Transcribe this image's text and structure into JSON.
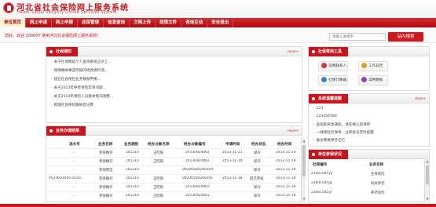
{
  "header": {
    "title": "河北省社会保险网上服务系统",
    "subtitle": "Hebei Social Security Online Services System"
  },
  "nav": {
    "items": [
      {
        "label": "单位首页"
      },
      {
        "label": "网上申请"
      },
      {
        "label": "网上申报"
      },
      {
        "label": "总保管理"
      },
      {
        "label": "信息查询"
      },
      {
        "label": "文档上传"
      },
      {
        "label": "政策文件"
      },
      {
        "label": "咨询互动"
      },
      {
        "label": "安全退出"
      }
    ]
  },
  "notice": {
    "text": "您好，欢迎 10000T 使用河北社会保险网上服务系统!"
  },
  "search": {
    "placeholder": "请输入关键字",
    "button_label": "站内搜索"
  },
  "announcements": {
    "title": "社保通知",
    "more": "more+",
    "items": [
      "关于社保网站个人查询系统正式上...",
      "保障缴纳事宜所报的修改资料须...",
      "建立社会保险业务数据申报...",
      "关于2013年养老保险年审问题...",
      "关于2014年保险人员基本情况调整...",
      "管理社会保险缴纳登记费"
    ]
  },
  "business": {
    "title": "业务办理结果",
    "more": "more+",
    "columns": [
      "流水号",
      "业务名称",
      "业务期别",
      "经办对象名称",
      "经办对象编号",
      "申请时间",
      "经办状态",
      "经办时间"
    ],
    "rows": [
      [
        "…",
        "参保缴存",
        "201310",
        "王昭阳",
        "20130924002",
        "2013-11-21",
        "保存",
        "2013-11-19"
      ],
      [
        "…",
        "参保缴存",
        "201310",
        "王昭阳",
        "20130924002",
        "2013-11-19",
        "保存",
        "2013-11-19"
      ],
      [
        "…",
        "参保转出",
        "201310",
        "",
        "00200500200304",
        "",
        "保存",
        "2013-11-19"
      ],
      [
        "0523601045-1020...",
        "参保缴存",
        "201310",
        "王昭阳",
        "00200500200301",
        "2013-11-18",
        "提交审核",
        "2013-11-18"
      ],
      [
        "…",
        "参保缴存",
        "201310",
        "王昭阳",
        "20130924002",
        "",
        "保存",
        "2013-11-18"
      ],
      [
        "…",
        "参保缴存",
        "201310",
        "王昭阳",
        "20130924002",
        "",
        "保存",
        "2013-11-18"
      ]
    ]
  },
  "tools": {
    "title": "社保常用工具",
    "items": [
      {
        "label": "常用联系人",
        "color": "#d9363b",
        "icon": "contacts-icon"
      },
      {
        "label": "工作日历",
        "color": "#e3a11b",
        "icon": "calendar-icon"
      },
      {
        "label": "社保计算器",
        "color": "#3b7fd1",
        "icon": "calculator-icon"
      },
      {
        "label": "常用数据",
        "color": "#9b3fb6",
        "icon": "data-icon"
      }
    ]
  },
  "messages": {
    "title": "系统温馨提醒",
    "more": "more+",
    "items": [
      "123",
      "123456789",
      "监控系统会通知，请在确认后保存",
      "一线保险社保单，立即会议定时提醒",
      "备份需要保存记忆"
    ]
  },
  "pending": {
    "title": "单位参保状况",
    "columns": [
      "社保编号",
      "业务名称"
    ],
    "rows": [
      [
        "23601045yy",
        "生育保险"
      ],
      [
        "23601045jg",
        "机关养老"
      ],
      [
        "23601045yl",
        "养老保险"
      ]
    ]
  }
}
